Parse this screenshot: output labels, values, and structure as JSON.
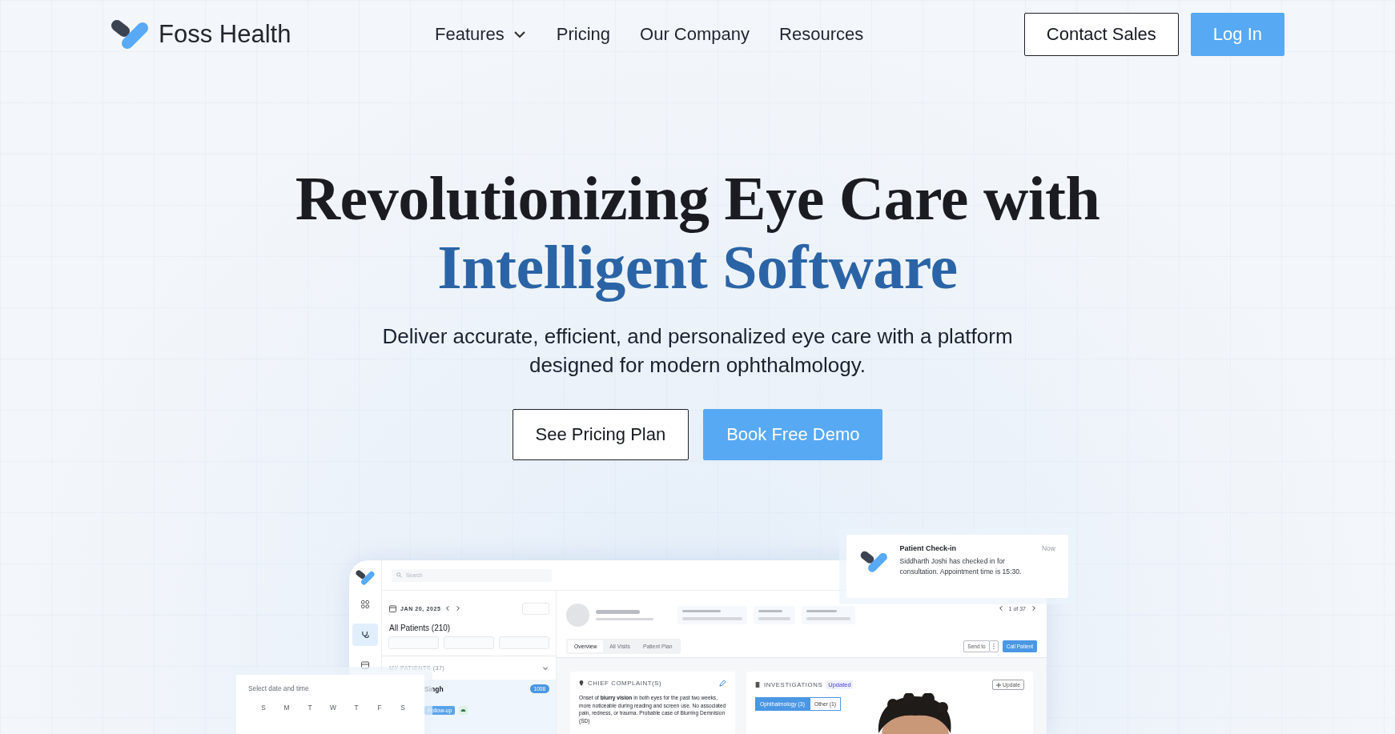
{
  "brand": {
    "name": "Foss Health"
  },
  "nav": [
    {
      "label": "Features",
      "kind": "dropdown"
    },
    {
      "label": "Pricing",
      "kind": "link"
    },
    {
      "label": "Our Company",
      "kind": "link"
    },
    {
      "label": "Resources",
      "kind": "link"
    }
  ],
  "actions": [
    {
      "label": "Contact Sales",
      "kind": "outline"
    },
    {
      "label": "Log In",
      "kind": "primary"
    }
  ],
  "hero": {
    "title_line_1": "Revolutionizing Eye Care with",
    "title_line_2": "Intelligent Software",
    "subtitle": "Deliver accurate, efficient, and personalized eye care with a platform designed for modern ophthalmology.",
    "buttons": [
      {
        "label": "See Pricing Plan",
        "kind": "outline"
      },
      {
        "label": "Book Free Demo",
        "kind": "primary"
      }
    ]
  },
  "app_preview": {
    "search": {
      "placeholder": "Search"
    },
    "sidebar": [
      {
        "selected": false
      },
      {
        "selected": true
      },
      {
        "selected": false
      }
    ],
    "date": "JAN 20, 2025",
    "list_title": "All Patients (210)",
    "section_title": "MY PATIENTS (37)",
    "patient": {
      "name": "Singh",
      "badge": "1008",
      "tag": "Follow-up"
    },
    "pager": "1 of 37",
    "tabs": [
      {
        "label": "Overview",
        "selected": true
      },
      {
        "label": "All Visits",
        "selected": false
      },
      {
        "label": "Patient Plan",
        "selected": false
      }
    ],
    "send_button": "Send to",
    "call_button": "Call Patient",
    "complaint": {
      "title": "CHIEF COMPLAINT(S)",
      "text": "Onset of **blurry vision** in both eyes for the past two weeks, more noticeable during reading and screen use. No associated pain, redness, or trauma. Probable case of Blurring Demnision (SD)"
    },
    "investigations": {
      "title": "INVESTIGATIONS",
      "badge": "Updated",
      "update_button": "Update",
      "segments": [
        {
          "label": "Ophthalmology (3)",
          "selected": true
        },
        {
          "label": "Other (1)",
          "selected": false
        }
      ]
    }
  },
  "notification": {
    "title": "Patient Check-in",
    "time": "Now",
    "message": "Siddharth Joshi has checked in for consultation. Appointment time is 15:30."
  },
  "calendar": {
    "title": "Select date and time",
    "weekdays": [
      "S",
      "M",
      "T",
      "W",
      "T",
      "F",
      "S"
    ]
  }
}
